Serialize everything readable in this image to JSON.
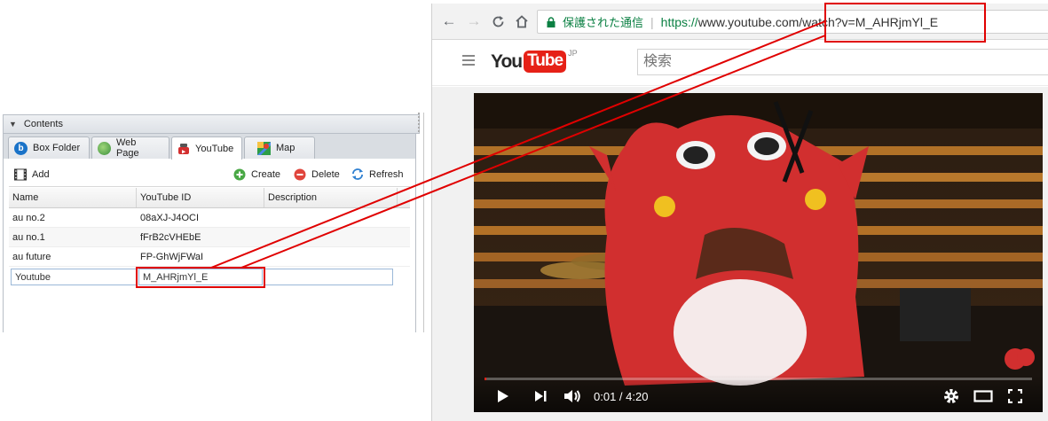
{
  "panel": {
    "title": "Contents",
    "tabs": [
      {
        "label": "Box Folder",
        "icon": "box-icon",
        "active": false
      },
      {
        "label": "Web Page",
        "icon": "globe-icon",
        "active": false
      },
      {
        "label": "YouTube",
        "icon": "youtube-icon",
        "active": true
      },
      {
        "label": "Map",
        "icon": "map-icon",
        "active": false
      }
    ],
    "toolbar": {
      "add": "Add",
      "create": "Create",
      "delete": "Delete",
      "refresh": "Refresh"
    },
    "columns": [
      "Name",
      "YouTube ID",
      "Description"
    ],
    "rows": [
      {
        "name": "au no.2",
        "id": "08aXJ-J4OCI",
        "desc": ""
      },
      {
        "name": "au no.1",
        "id": "fFrB2cVHEbE",
        "desc": ""
      },
      {
        "name": "au future",
        "id": "FP-GhWjFWaI",
        "desc": ""
      }
    ],
    "edit_row": {
      "name": "Youtube",
      "id": "M_AHRjmYl_E",
      "desc": ""
    }
  },
  "browser": {
    "secure_label": "保護された通信",
    "protocol": "https://",
    "url": "www.youtube.com/watch?v=M_AHRjmYl_E",
    "yt_logo_you": "You",
    "yt_logo_tube": "Tube",
    "yt_logo_region": "JP",
    "search_placeholder": "検索",
    "player": {
      "time": "0:01 / 4:20",
      "progress": 0.004
    }
  },
  "colors": {
    "highlight": "#e00000",
    "youtube_red": "#e62117",
    "secure_green": "#0b8043"
  }
}
